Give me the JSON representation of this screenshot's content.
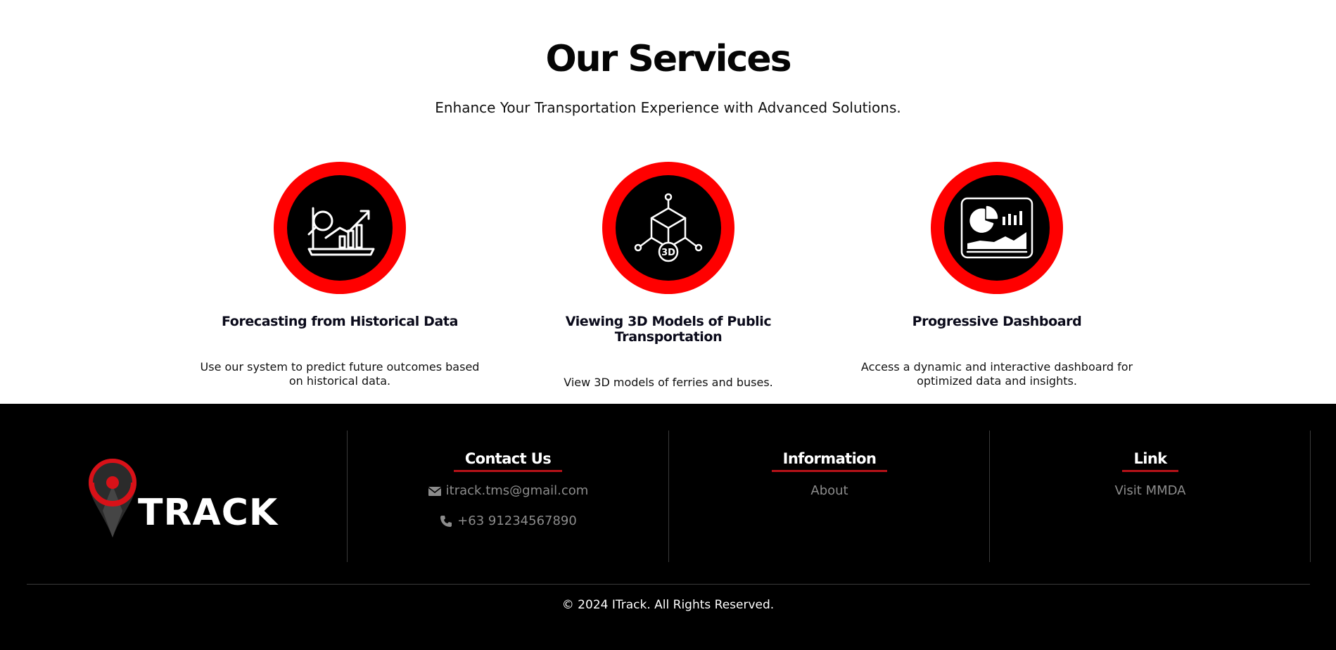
{
  "services": {
    "title": "Our Services",
    "subtitle": "Enhance Your Transportation Experience with Advanced Solutions.",
    "cards": [
      {
        "icon": "forecast-chart-icon",
        "title": "Forecasting from Historical Data",
        "description": "Use our system to predict future outcomes based on historical data."
      },
      {
        "icon": "3d-cube-icon",
        "title": "Viewing 3D Models of Public Transportation",
        "description": "View 3D models of ferries and buses."
      },
      {
        "icon": "dashboard-icon",
        "title": "Progressive Dashboard",
        "description": "Access a dynamic and interactive dashboard for optimized data and insights."
      }
    ]
  },
  "footer": {
    "brand": "TRACK",
    "columns": [
      {
        "title": "Contact Us",
        "items": [
          {
            "icon": "envelope-icon",
            "text": "itrack.tms@gmail.com"
          },
          {
            "icon": "phone-icon",
            "text": "+63 91234567890"
          }
        ]
      },
      {
        "title": "Information",
        "items": [
          {
            "text": "About"
          }
        ]
      },
      {
        "title": "Link",
        "items": [
          {
            "text": "Visit MMDA"
          }
        ]
      }
    ],
    "copyright": "© 2024 ITrack. All Rights Reserved."
  },
  "colors": {
    "accent": "#ff0000",
    "underline": "#b51218",
    "footer_bg": "#000000"
  }
}
